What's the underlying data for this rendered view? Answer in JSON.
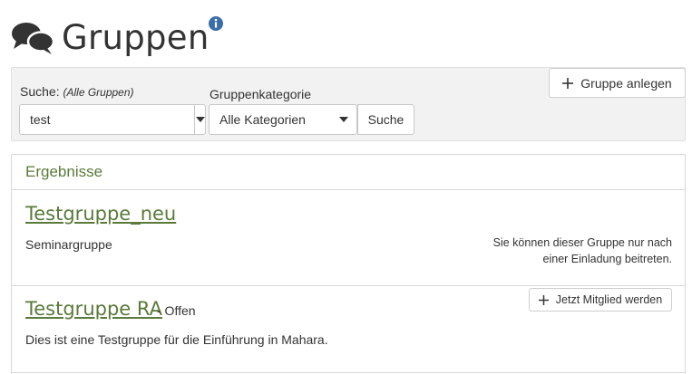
{
  "page": {
    "title": "Gruppen",
    "header_icon": "chat-bubbles-icon",
    "info_icon": "info-icon",
    "accent_color": "#5a7a3a",
    "info_color": "#3b6ea8"
  },
  "search": {
    "label": "Suche:",
    "scope_hint": "(Alle Gruppen)",
    "value": "test",
    "category_label": "Gruppenkategorie",
    "category_selected": "Alle Kategorien",
    "search_button": "Suche",
    "create_button": "Gruppe anlegen"
  },
  "results": {
    "heading": "Ergebnisse",
    "groups": [
      {
        "name": "Testgruppe_neu",
        "status": "",
        "description": "Seminargruppe",
        "note": "Sie können dieser Gruppe nur nach einer Einladung beitreten.",
        "action": ""
      },
      {
        "name": "Testgruppe RA",
        "status": "- Offen",
        "description": "Dies ist eine Testgruppe für die Einführung in Mahara.",
        "note": "",
        "action": "Jetzt Mitglied werden"
      }
    ]
  }
}
